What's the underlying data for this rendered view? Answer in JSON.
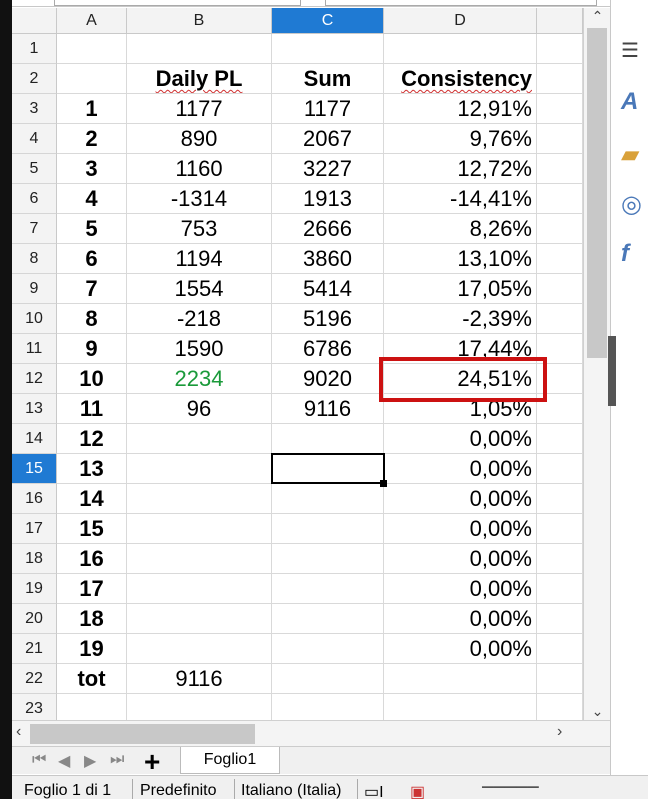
{
  "columns": [
    "A",
    "B",
    "C",
    "D"
  ],
  "active_column": "C",
  "active_row": "15",
  "rows": [
    {
      "row": "1",
      "a": "",
      "b": "",
      "c": "",
      "d": ""
    },
    {
      "row": "2",
      "a": "",
      "b": "Daily PL",
      "c": "Sum",
      "d": "Consistency"
    },
    {
      "row": "3",
      "a": "1",
      "b": "1177",
      "c": "1177",
      "d": "12,91%"
    },
    {
      "row": "4",
      "a": "2",
      "b": "890",
      "c": "2067",
      "d": "9,76%"
    },
    {
      "row": "5",
      "a": "3",
      "b": "1160",
      "c": "3227",
      "d": "12,72%"
    },
    {
      "row": "6",
      "a": "4",
      "b": "-1314",
      "c": "1913",
      "d": "-14,41%"
    },
    {
      "row": "7",
      "a": "5",
      "b": "753",
      "c": "2666",
      "d": "8,26%"
    },
    {
      "row": "8",
      "a": "6",
      "b": "1194",
      "c": "3860",
      "d": "13,10%"
    },
    {
      "row": "9",
      "a": "7",
      "b": "1554",
      "c": "5414",
      "d": "17,05%"
    },
    {
      "row": "10",
      "a": "8",
      "b": "-218",
      "c": "5196",
      "d": "-2,39%"
    },
    {
      "row": "11",
      "a": "9",
      "b": "1590",
      "c": "6786",
      "d": "17,44%"
    },
    {
      "row": "12",
      "a": "10",
      "b": "2234",
      "c": "9020",
      "d": "24,51%"
    },
    {
      "row": "13",
      "a": "11",
      "b": "96",
      "c": "9116",
      "d": "1,05%"
    },
    {
      "row": "14",
      "a": "12",
      "b": "",
      "c": "",
      "d": "0,00%"
    },
    {
      "row": "15",
      "a": "13",
      "b": "",
      "c": "",
      "d": "0,00%"
    },
    {
      "row": "16",
      "a": "14",
      "b": "",
      "c": "",
      "d": "0,00%"
    },
    {
      "row": "17",
      "a": "15",
      "b": "",
      "c": "",
      "d": "0,00%"
    },
    {
      "row": "18",
      "a": "16",
      "b": "",
      "c": "",
      "d": "0,00%"
    },
    {
      "row": "19",
      "a": "17",
      "b": "",
      "c": "",
      "d": "0,00%"
    },
    {
      "row": "20",
      "a": "18",
      "b": "",
      "c": "",
      "d": "0,00%"
    },
    {
      "row": "21",
      "a": "19",
      "b": "",
      "c": "",
      "d": "0,00%"
    },
    {
      "row": "22",
      "a": "tot",
      "b": "9116",
      "c": "",
      "d": ""
    },
    {
      "row": "23",
      "a": "",
      "b": "",
      "c": "",
      "d": ""
    }
  ],
  "highlight": {
    "green_cell": "B12",
    "green_color": "#1a9a3a",
    "annotation_color": "#cc1111"
  },
  "sheet_tab": "Foglio1",
  "status": {
    "sheet": "Foglio 1 di 1",
    "style": "Predefinito",
    "language": "Italiano (Italia)"
  },
  "icons": {
    "scroll_up": "chevron-up-icon",
    "scroll_down": "chevron-down-icon",
    "add_sheet": "plus-icon"
  }
}
